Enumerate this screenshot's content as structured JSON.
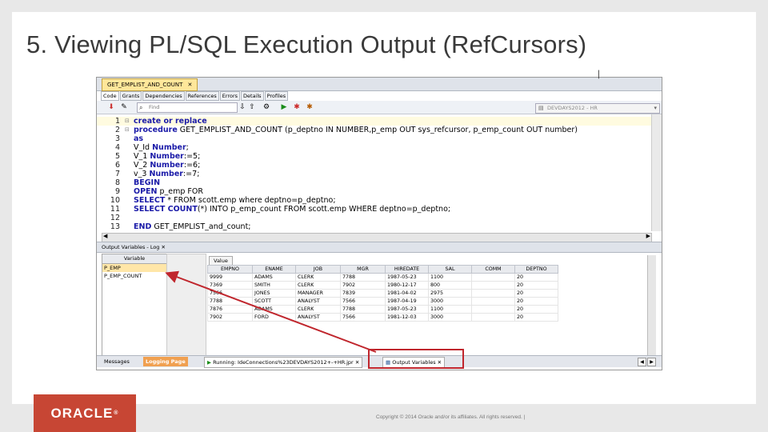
{
  "slide": {
    "title": "5. Viewing PL/SQL Execution Output (RefCursors)",
    "copyright": "Copyright © 2014 Oracle and/or its affiliates. All rights reserved.  |",
    "logo_text": "ORACLE"
  },
  "editor": {
    "doc_tab": "GET_EMPLIST_AND_COUNT",
    "sub_tabs": [
      "Code",
      "Grants",
      "Dependencies",
      "References",
      "Errors",
      "Details",
      "Profiles"
    ],
    "find_placeholder": "Find",
    "connection": "DEVDAYS2012 - HR",
    "lines": [
      {
        "n": "1",
        "pre": "",
        "kw1": "create or replace",
        "rest": ""
      },
      {
        "n": "2",
        "pre": "",
        "kw1": "procedure",
        "rest": " GET_EMPLIST_AND_COUNT (p_deptno IN NUMBER,p_emp OUT sys_refcursor, p_emp_count OUT number)"
      },
      {
        "n": "3",
        "pre": "",
        "kw1": "as",
        "rest": ""
      },
      {
        "n": "4",
        "pre": "V_Id ",
        "kw1": "Number",
        "rest": ";"
      },
      {
        "n": "5",
        "pre": "V_1 ",
        "kw1": "Number",
        "rest": ":=5;"
      },
      {
        "n": "6",
        "pre": "V_2 ",
        "kw1": "Number",
        "rest": ":=6;"
      },
      {
        "n": "7",
        "pre": "v_3 ",
        "kw1": "Number",
        "rest": ":=7;"
      },
      {
        "n": "8",
        "pre": "",
        "kw1": "BEGIN",
        "rest": ""
      },
      {
        "n": "9",
        "pre": "",
        "kw1": "OPEN",
        "rest": " p_emp FOR"
      },
      {
        "n": "10",
        "pre": "",
        "kw1": "SELECT",
        "rest": " * FROM scott.emp where deptno=p_deptno;"
      },
      {
        "n": "11",
        "pre": "",
        "kw1": "SELECT COUNT",
        "rest": "(*) INTO p_emp_count FROM scott.emp WHERE deptno=p_deptno;"
      },
      {
        "n": "12",
        "pre": "",
        "kw1": "",
        "rest": ""
      },
      {
        "n": "13",
        "pre": "",
        "kw1": "END",
        "rest": " GET_EMPLIST_and_count;"
      }
    ]
  },
  "output": {
    "panel_title": "Output Variables - Log",
    "variable_header": "Variable",
    "variables": [
      "P_EMP",
      "P_EMP_COUNT"
    ],
    "value_tab": "Value",
    "columns": [
      "EMPNO",
      "ENAME",
      "JOB",
      "MGR",
      "HIREDATE",
      "SAL",
      "COMM",
      "DEPTNO"
    ],
    "rows": [
      [
        "9999",
        "ADAMS",
        "CLERK",
        "7788",
        "1987-05-23",
        "1100",
        "",
        "20"
      ],
      [
        "7369",
        "SMITH",
        "CLERK",
        "7902",
        "1980-12-17",
        "800",
        "",
        "20"
      ],
      [
        "7566",
        "JONES",
        "MANAGER",
        "7839",
        "1981-04-02",
        "2975",
        "",
        "20"
      ],
      [
        "7788",
        "SCOTT",
        "ANALYST",
        "7566",
        "1987-04-19",
        "3000",
        "",
        "20"
      ],
      [
        "7876",
        "ADAMS",
        "CLERK",
        "7788",
        "1987-05-23",
        "1100",
        "",
        "20"
      ],
      [
        "7902",
        "FORD",
        "ANALYST",
        "7566",
        "1981-12-03",
        "3000",
        "",
        "20"
      ]
    ]
  },
  "status_bar": {
    "messages": "Messages",
    "logging": "Logging Page",
    "running": "Running: IdeConnections%23DEVDAYS2012+-+HR.jpr",
    "output_variables": "Output Variables"
  },
  "colors": {
    "oracle_red": "#c74634",
    "highlight_red": "#c0262d",
    "keyword_blue": "#1a1aa8"
  }
}
